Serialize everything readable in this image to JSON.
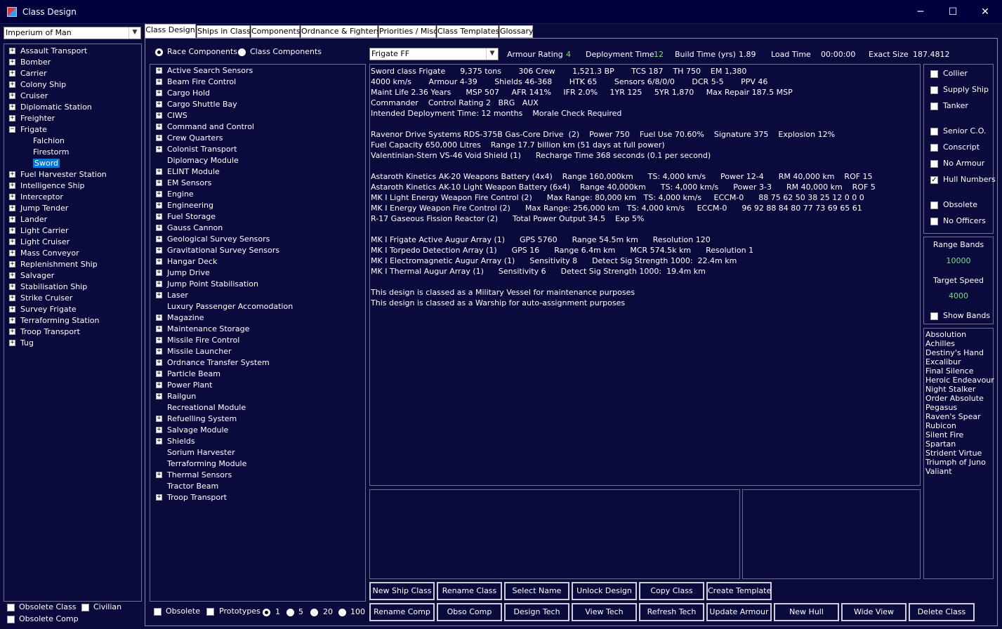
{
  "window": {
    "title": "Class Design",
    "minimize": "─",
    "maximize": "☐",
    "close": "✕"
  },
  "race_select": {
    "value": "Imperium of Man"
  },
  "hull_tree": [
    {
      "label": "Assault Transport",
      "expander": "+"
    },
    {
      "label": "Bomber",
      "expander": "+"
    },
    {
      "label": "Carrier",
      "expander": "+"
    },
    {
      "label": "Colony Ship",
      "expander": "+"
    },
    {
      "label": "Cruiser",
      "expander": "+"
    },
    {
      "label": "Diplomatic Station",
      "expander": "+"
    },
    {
      "label": "Freighter",
      "expander": "+"
    },
    {
      "label": "Frigate",
      "expander": "−"
    },
    {
      "label": "Falchion",
      "child": true
    },
    {
      "label": "Firestorm",
      "child": true
    },
    {
      "label": "Sword",
      "child": true,
      "selected": true
    },
    {
      "label": "Fuel Harvester Station",
      "expander": "+"
    },
    {
      "label": "Intelligence Ship",
      "expander": "+"
    },
    {
      "label": "Interceptor",
      "expander": "+"
    },
    {
      "label": "Jump Tender",
      "expander": "+"
    },
    {
      "label": "Lander",
      "expander": "+"
    },
    {
      "label": "Light Carrier",
      "expander": "+"
    },
    {
      "label": "Light Cruiser",
      "expander": "+"
    },
    {
      "label": "Mass Conveyor",
      "expander": "+"
    },
    {
      "label": "Replenishment Ship",
      "expander": "+"
    },
    {
      "label": "Salvager",
      "expander": "+"
    },
    {
      "label": "Stabilisation Ship",
      "expander": "+"
    },
    {
      "label": "Strike Cruiser",
      "expander": "+"
    },
    {
      "label": "Survey Frigate",
      "expander": "+"
    },
    {
      "label": "Terraforming Station",
      "expander": "+"
    },
    {
      "label": "Troop Transport",
      "expander": "+"
    },
    {
      "label": "Tug",
      "expander": "+"
    }
  ],
  "left_checks": {
    "obsolete_class": "Obsolete Class",
    "civilian": "Civilian",
    "obsolete_comp": "Obsolete Comp"
  },
  "tabs": [
    "Class Design",
    "Ships in Class",
    "Components",
    "Ordnance & Fighters",
    "Priorities / Misc",
    "Class Templates",
    "Glossary"
  ],
  "component_source": {
    "race": "Race Components",
    "class": "Class Components"
  },
  "components": [
    {
      "label": "Active Search Sensors",
      "expander": "+"
    },
    {
      "label": "Beam Fire Control",
      "expander": "+"
    },
    {
      "label": "Cargo Hold",
      "expander": "+"
    },
    {
      "label": "Cargo Shuttle Bay",
      "expander": "+"
    },
    {
      "label": "CIWS",
      "expander": "+"
    },
    {
      "label": "Command and Control",
      "expander": "+"
    },
    {
      "label": "Crew Quarters",
      "expander": "+"
    },
    {
      "label": "Colonist Transport",
      "expander": "+"
    },
    {
      "label": "Diplomacy Module"
    },
    {
      "label": "ELINT Module",
      "expander": "+"
    },
    {
      "label": "EM Sensors",
      "expander": "+"
    },
    {
      "label": "Engine",
      "expander": "+"
    },
    {
      "label": "Engineering",
      "expander": "+"
    },
    {
      "label": "Fuel Storage",
      "expander": "+"
    },
    {
      "label": "Gauss Cannon",
      "expander": "+"
    },
    {
      "label": "Geological Survey Sensors",
      "expander": "+"
    },
    {
      "label": "Gravitational Survey Sensors",
      "expander": "+"
    },
    {
      "label": "Hangar Deck",
      "expander": "+"
    },
    {
      "label": "Jump Drive",
      "expander": "+"
    },
    {
      "label": "Jump Point Stabilisation",
      "expander": "+"
    },
    {
      "label": "Laser",
      "expander": "+"
    },
    {
      "label": "Luxury Passenger Accomodation"
    },
    {
      "label": "Magazine",
      "expander": "+"
    },
    {
      "label": "Maintenance Storage",
      "expander": "+"
    },
    {
      "label": "Missile Fire Control",
      "expander": "+"
    },
    {
      "label": "Missile Launcher",
      "expander": "+"
    },
    {
      "label": "Ordnance Transfer System",
      "expander": "+"
    },
    {
      "label": "Particle Beam",
      "expander": "+"
    },
    {
      "label": "Power Plant",
      "expander": "+"
    },
    {
      "label": "Railgun",
      "expander": "+"
    },
    {
      "label": "Recreational Module"
    },
    {
      "label": "Refuelling System",
      "expander": "+"
    },
    {
      "label": "Salvage Module",
      "expander": "+"
    },
    {
      "label": "Shields",
      "expander": "+"
    },
    {
      "label": "Sorium Harvester"
    },
    {
      "label": "Terraforming Module"
    },
    {
      "label": "Thermal Sensors",
      "expander": "+"
    },
    {
      "label": "Tractor Beam"
    },
    {
      "label": "Troop Transport",
      "expander": "+"
    }
  ],
  "comp_filters": {
    "obsolete": "Obsolete",
    "prototypes": "Prototypes",
    "qty": [
      "1",
      "5",
      "20",
      "100"
    ]
  },
  "header": {
    "hull_type": "Frigate  FF",
    "armour_label": "Armour Rating",
    "armour_value": "4",
    "deploy_label": "Deployment Time",
    "deploy_value": "12",
    "build_label": "Build Time (yrs)",
    "build_value": "1.89",
    "load_label": "Load Time",
    "load_value": "00:00:00",
    "size_label": "Exact Size",
    "size_value": "187.4812"
  },
  "summary": [
    "Sword class Frigate      9,375 tons       306 Crew       1,521.3 BP       TCS 187    TH 750    EM 1,380",
    "4000 km/s       Armour 4-39       Shields 46-368       HTK 65       Sensors 6/8/0/0       DCR 5-5       PPV 46",
    "Maint Life 2.36 Years      MSP 507     AFR 141%     IFR 2.0%     1YR 125     5YR 1,870     Max Repair 187.5 MSP",
    "Commander    Control Rating 2   BRG   AUX",
    "Intended Deployment Time: 12 months    Morale Check Required",
    "",
    "Ravenor Drive Systems RDS-375B Gas-Core Drive  (2)    Power 750    Fuel Use 70.60%    Signature 375    Explosion 12%",
    "Fuel Capacity 650,000 Litres    Range 17.7 billion km (51 days at full power)",
    "Valentinian-Stern VS-46 Void Shield (1)      Recharge Time 368 seconds (0.1 per second)",
    "",
    "Astaroth Kinetics AK-20 Weapons Battery (4x4)    Range 160,000km      TS: 4,000 km/s      Power 12-4      RM 40,000 km    ROF 15",
    "Astaroth Kinetics AK-10 Light Weapon Battery (6x4)    Range 40,000km      TS: 4,000 km/s      Power 3-3      RM 40,000 km    ROF 5",
    "MK I Light Energy Weapon Fire Control (2)      Max Range: 80,000 km   TS: 4,000 km/s     ECCM-0      88 75 62 50 38 25 12 0 0 0",
    "MK I Energy Weapon Fire Control (2)      Max Range: 256,000 km   TS: 4,000 km/s     ECCM-0      96 92 88 84 80 77 73 69 65 61",
    "R-17 Gaseous Fission Reactor (2)      Total Power Output 34.5    Exp 5%",
    "",
    "MK I Frigate Active Augur Array (1)      GPS 5760      Range 54.5m km      Resolution 120",
    "MK I Torpedo Detection Array (1)      GPS 16      Range 6.4m km      MCR 574.5k km      Resolution 1",
    "MK I Electromagnetic Augur Array (1)      Sensitivity 8      Detect Sig Strength 1000:  22.4m km",
    "MK I Thermal Augur Array (1)      Sensitivity 6      Detect Sig Strength 1000:  19.4m km",
    "",
    "This design is classed as a Military Vessel for maintenance purposes",
    "This design is classed as a Warship for auto-assignment purposes"
  ],
  "options": [
    {
      "label": "Collier",
      "checked": false
    },
    {
      "label": "Supply Ship",
      "checked": false
    },
    {
      "label": "Tanker",
      "checked": false
    },
    {
      "label": "Senior C.O.",
      "checked": false
    },
    {
      "label": "Conscript",
      "checked": false
    },
    {
      "label": "No Armour",
      "checked": false
    },
    {
      "label": "Hull Numbers",
      "checked": true
    },
    {
      "label": "Obsolete",
      "checked": false
    },
    {
      "label": "No Officers",
      "checked": false
    }
  ],
  "range": {
    "bands_label": "Range Bands",
    "bands_value": "10000",
    "speed_label": "Target Speed",
    "speed_value": "4000",
    "show_bands": "Show Bands"
  },
  "ship_names": [
    "Absolution",
    "Achilles",
    "Destiny's Hand",
    "Excalibur",
    "Final Silence",
    "Heroic Endeavour",
    "Night Stalker",
    "Order Absolute",
    "Pegasus",
    "Raven's Spear",
    "Rubicon",
    "Silent Fire",
    "Spartan",
    "Strident Virtue",
    "Triumph of Juno",
    "Valiant"
  ],
  "buttons_row1": [
    "New Ship Class",
    "Rename Class",
    "Select Name",
    "Unlock Design",
    "Copy Class",
    "Create Template"
  ],
  "buttons_row2": [
    "Rename Comp",
    "Obso Comp",
    "Design Tech",
    "View Tech",
    "Refresh Tech",
    "Update Armour",
    "New Hull",
    "Wide View",
    "Delete Class"
  ],
  "colors": {
    "background": "#0a0a3c",
    "value_green": "#7ddd7d",
    "selection": "#0078d7"
  }
}
